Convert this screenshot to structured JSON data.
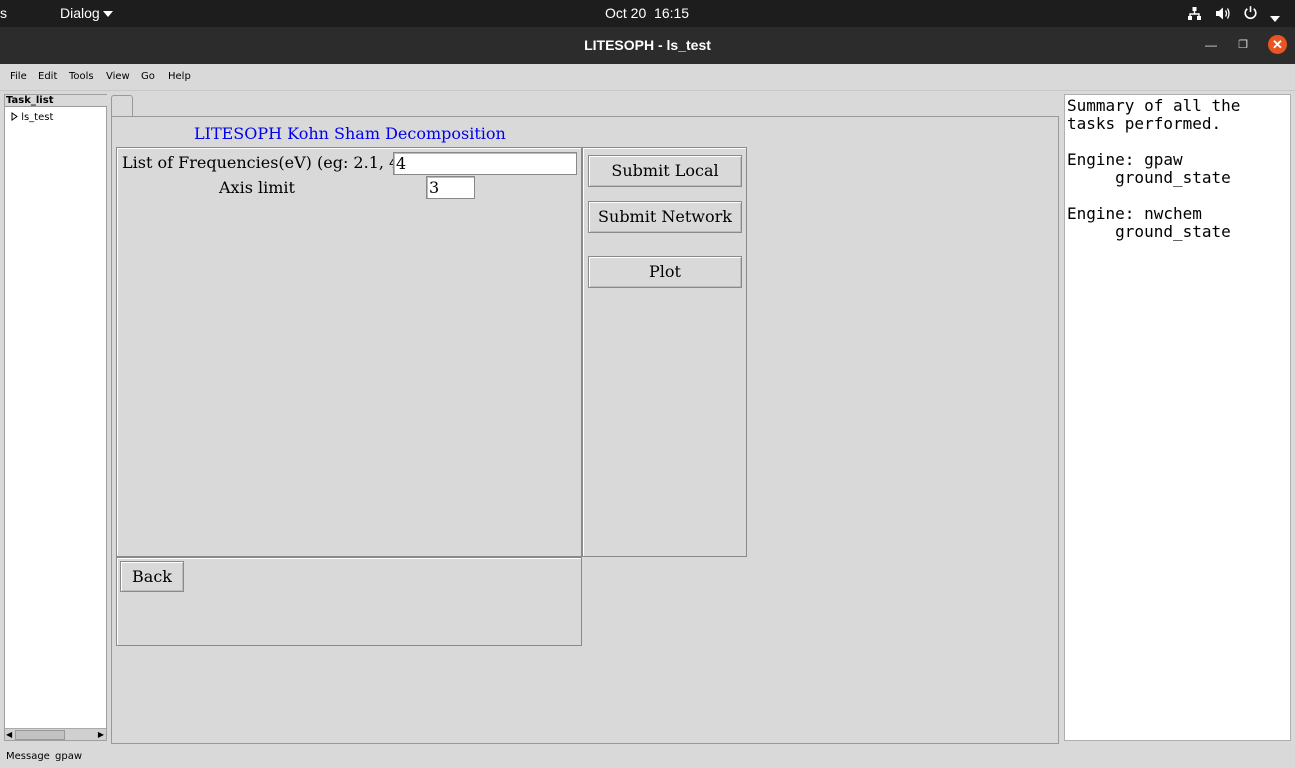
{
  "topbar": {
    "left_fragment": "s",
    "app_menu": "Dialog",
    "date": "Oct 20",
    "time": "16:15"
  },
  "window": {
    "title": "LITESOPH - ls_test"
  },
  "menubar": {
    "items": [
      "File",
      "Edit",
      "Tools",
      "View",
      "Go",
      "Help"
    ]
  },
  "task_list": {
    "header": "Task_list",
    "items": [
      {
        "label": "ls_test"
      }
    ]
  },
  "main": {
    "heading": "LITESOPH Kohn Sham Decomposition",
    "frequencies_label": "List of Frequencies(eV) (eg: 2.1, 4)",
    "frequencies_value": "4",
    "axis_label": "Axis limit",
    "axis_value": "3",
    "submit_local": "Submit Local",
    "submit_network": "Submit Network",
    "plot": "Plot",
    "back": "Back"
  },
  "summary": {
    "text": "Summary of all the\ntasks performed.\n\nEngine: gpaw\n     ground_state\n\nEngine: nwchem\n     ground_state"
  },
  "status": {
    "label": "Message",
    "value": "gpaw"
  }
}
